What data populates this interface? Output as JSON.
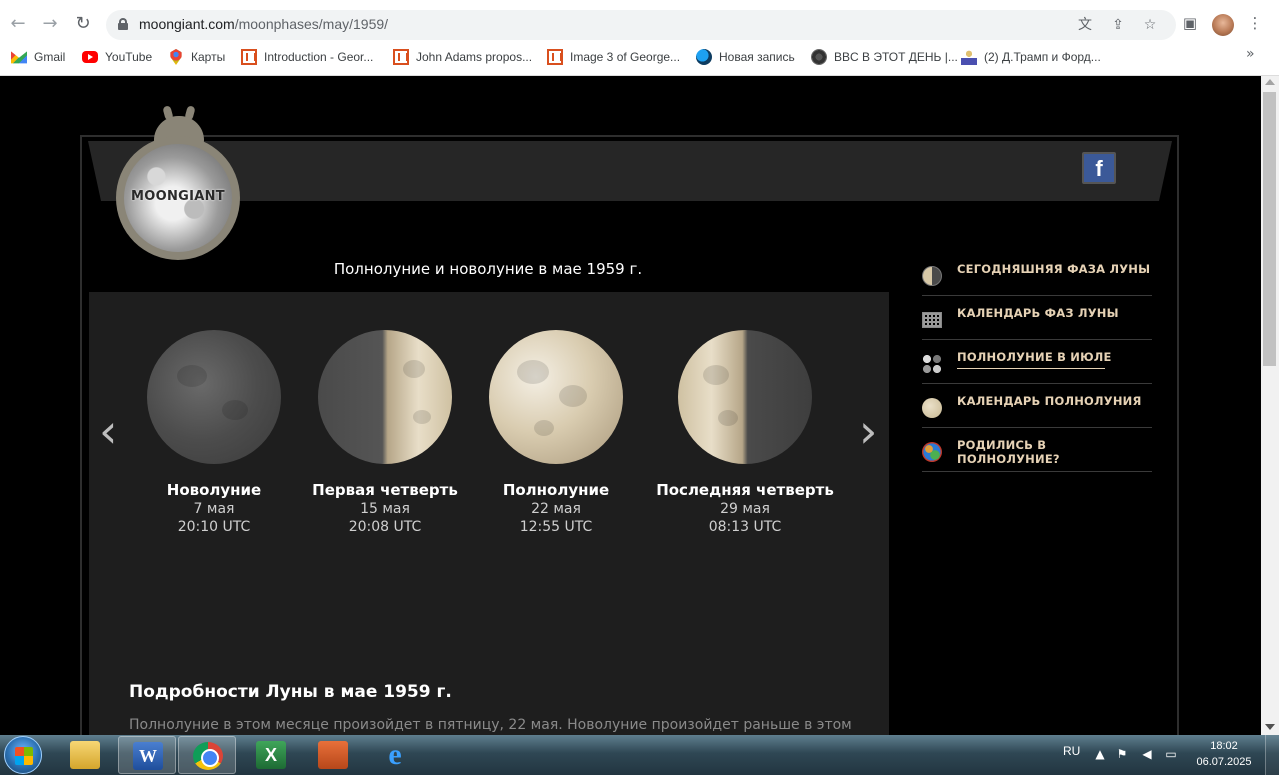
{
  "browser": {
    "url_host": "moongiant.com",
    "url_path": "/moonphases/may/1959/",
    "bookmarks": [
      {
        "label": "Gmail",
        "icon": "gmail-icon"
      },
      {
        "label": "YouTube",
        "icon": "youtube-icon"
      },
      {
        "label": "Карты",
        "icon": "maps-icon"
      },
      {
        "label": "Introduction - Geor...",
        "icon": "document-icon"
      },
      {
        "label": "John Adams propos...",
        "icon": "document-icon"
      },
      {
        "label": "Image 3 of George...",
        "icon": "document-icon"
      },
      {
        "label": "Новая запись",
        "icon": "bird-icon"
      },
      {
        "label": "BBC В ЭТОТ ДЕНЬ |...",
        "icon": "globe-icon"
      },
      {
        "label": "(2) Д.Трамп и Форд...",
        "icon": "person-icon"
      }
    ],
    "more_bookmarks": "»"
  },
  "site": {
    "logo_text": "MOONGIANT",
    "facebook": "f",
    "page_title": "Полнолуние и новолуние в мае 1959 г.",
    "arrow_prev": "‹",
    "arrow_next": "›",
    "phases": [
      {
        "name": "Новолуние",
        "date": "7 мая",
        "time": "20:10 UTC",
        "kind": "new"
      },
      {
        "name": "Первая четверть",
        "date": "15 мая",
        "time": "20:08 UTC",
        "kind": "first-quarter"
      },
      {
        "name": "Полнолуние",
        "date": "22 мая",
        "time": "12:55 UTC",
        "kind": "full"
      },
      {
        "name": "Последняя четверть",
        "date": "29 мая",
        "time": "08:13 UTC",
        "kind": "last-quarter"
      }
    ],
    "details_title": "Подробности Луны в мае 1959 г.",
    "details_text": "Полнолуние в этом месяце произойдет в пятницу, 22 мая. Новолуние произойдет раньше в этом",
    "menu": [
      {
        "label": "СЕГОДНЯШНЯЯ ФАЗА ЛУНЫ",
        "icon": "half-moon-icon"
      },
      {
        "label": "КАЛЕНДАРЬ ФАЗ ЛУНЫ",
        "icon": "calendar-grid-icon"
      },
      {
        "label": "ПОЛНОЛУНИЕ В ИЮЛЕ",
        "icon": "four-phases-icon"
      },
      {
        "label": "КАЛЕНДАРЬ ПОЛНОЛУНИЯ",
        "icon": "full-moon-icon"
      },
      {
        "label": "РОДИЛИСЬ В ПОЛНОЛУНИЕ?",
        "icon": "earth-icon"
      }
    ]
  },
  "taskbar": {
    "lang": "RU",
    "time": "18:02",
    "date": "06.07.2025",
    "apps": [
      "explorer-icon",
      "word-icon",
      "chrome-icon",
      "excel-icon",
      "powerpoint-icon",
      "internet-explorer-icon"
    ]
  }
}
